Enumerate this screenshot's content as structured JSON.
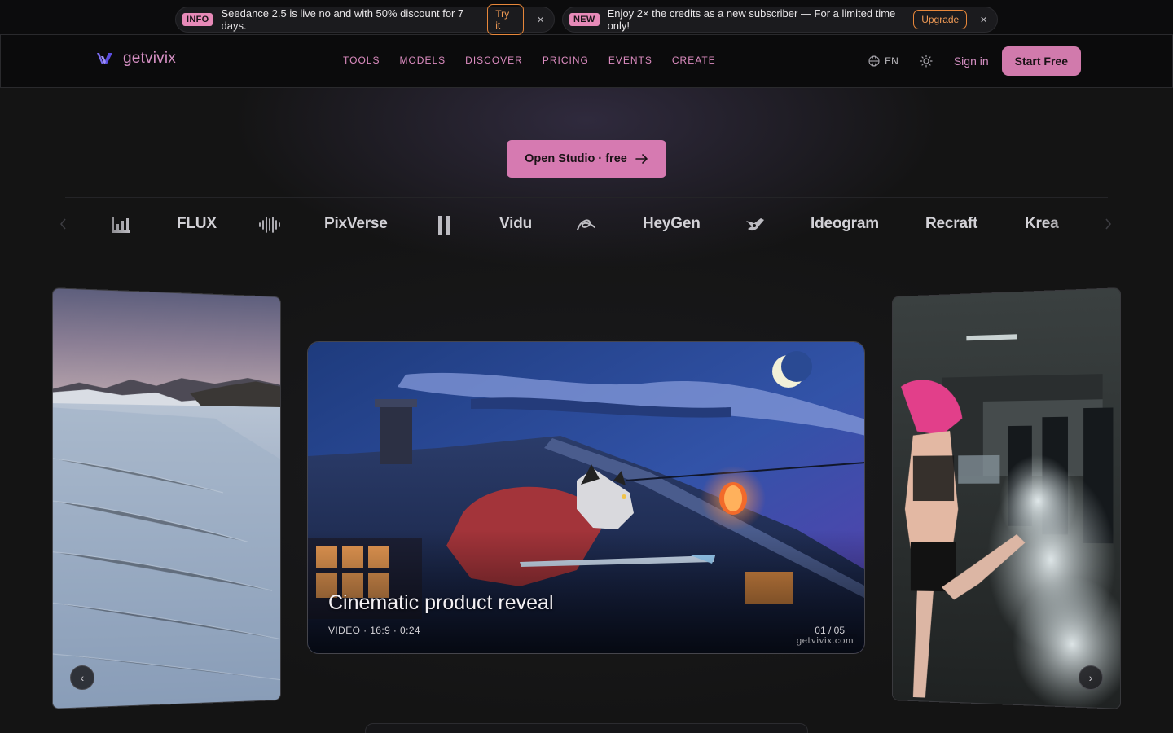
{
  "announcements": [
    {
      "tag": "INFO",
      "text": "Seedance 2.5 is live no and with 50% discount for 7 days.",
      "cta": "Try it",
      "close": "×"
    },
    {
      "tag": "NEW",
      "text": "Enjoy 2× the credits as a new subscriber — For a limited time only!",
      "cta": "Upgrade",
      "close": "×"
    }
  ],
  "brand": {
    "name": "getvivix",
    "icon": "vivix-logo-icon"
  },
  "nav": {
    "items": [
      "TOOLS",
      "MODELS",
      "DISCOVER",
      "PRICING",
      "EVENTS",
      "CREATE"
    ],
    "language": "EN",
    "language_icon": "globe-icon",
    "theme_icon": "sun-icon",
    "sign_in": "Sign in",
    "start_free": "Start Free"
  },
  "hero": {
    "cta": "Open Studio · free",
    "cta_icon": "arrow-right-icon"
  },
  "model_strip": {
    "items": [
      {
        "type": "icon",
        "name": "bars-logo-icon"
      },
      {
        "type": "text",
        "label": "FLUX"
      },
      {
        "type": "icon",
        "name": "waveform-logo-icon"
      },
      {
        "type": "text",
        "label": "PixVerse"
      },
      {
        "type": "icon",
        "name": "pause-logo-icon"
      },
      {
        "type": "text",
        "label": "Vidu"
      },
      {
        "type": "icon",
        "name": "swirl-logo-icon"
      },
      {
        "type": "text",
        "label": "HeyGen"
      },
      {
        "type": "icon",
        "name": "bird-logo-icon"
      },
      {
        "type": "text",
        "label": "Ideogram"
      },
      {
        "type": "text",
        "label": "Recraft"
      },
      {
        "type": "text",
        "label": "Krea"
      }
    ],
    "prev_icon": "chevron-left-icon",
    "next_icon": "chevron-right-icon"
  },
  "carousel": {
    "active": {
      "title": "Cinematic product reveal",
      "meta": "VIDEO · 16:9 · 0:24",
      "counter": "01 / 05",
      "watermark": "getvivix.com"
    },
    "prev_button": "‹",
    "next_button": "›"
  },
  "colors": {
    "accent": "#d67ab1",
    "brand_text": "#d58fc3",
    "warning": "#e7873a",
    "background": "#141414"
  }
}
